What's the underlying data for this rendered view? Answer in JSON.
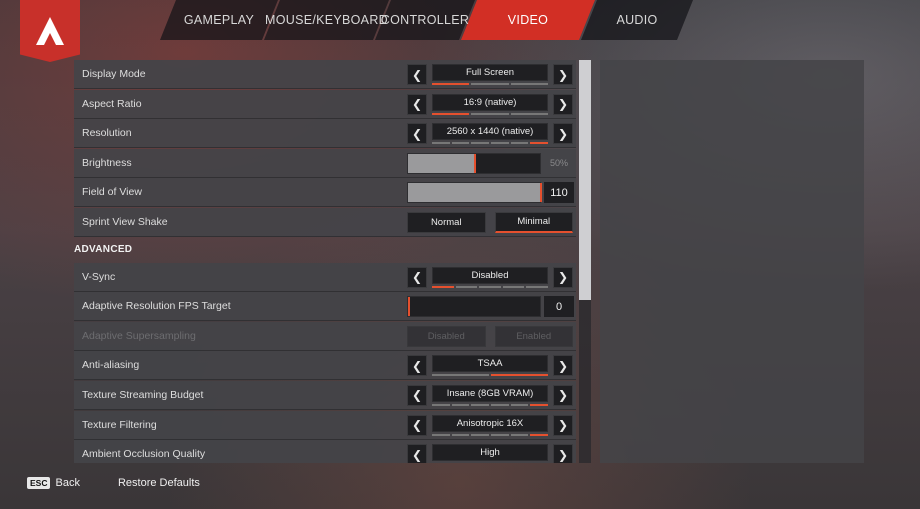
{
  "tabs": [
    {
      "label": "GAMEPLAY",
      "active": false
    },
    {
      "label": "MOUSE/KEYBOARD",
      "active": false
    },
    {
      "label": "CONTROLLER",
      "active": false
    },
    {
      "label": "VIDEO",
      "active": true
    },
    {
      "label": "AUDIO",
      "active": false
    }
  ],
  "settings": {
    "display_mode": {
      "label": "Display Mode",
      "value": "Full Screen",
      "option_index": 0,
      "option_count": 3
    },
    "aspect_ratio": {
      "label": "Aspect Ratio",
      "value": "16:9 (native)",
      "option_index": 0,
      "option_count": 3
    },
    "resolution": {
      "label": "Resolution",
      "value": "2560 x 1440 (native)",
      "option_index": 5,
      "option_count": 6
    },
    "brightness": {
      "label": "Brightness",
      "value": "50%",
      "fraction": 0.5
    },
    "fov": {
      "label": "Field of View",
      "value": "110",
      "fraction": 1.0
    },
    "sprint_view_shake": {
      "label": "Sprint View Shake",
      "options": [
        "Normal",
        "Minimal"
      ],
      "selected": "Minimal"
    }
  },
  "advanced_header": "ADVANCED",
  "advanced": {
    "vsync": {
      "label": "V-Sync",
      "value": "Disabled",
      "option_index": 0,
      "option_count": 5
    },
    "adaptive_res": {
      "label": "Adaptive Resolution FPS Target",
      "value": "0",
      "fraction": 0
    },
    "adaptive_ss": {
      "label": "Adaptive Supersampling",
      "options": [
        "Disabled",
        "Enabled"
      ]
    },
    "anti_aliasing": {
      "label": "Anti-aliasing",
      "value": "TSAA",
      "option_index": 1,
      "option_count": 2
    },
    "texture_budget": {
      "label": "Texture Streaming Budget",
      "value": "Insane (8GB VRAM)",
      "option_index": 5,
      "option_count": 6
    },
    "texture_filtering": {
      "label": "Texture Filtering",
      "value": "Anisotropic 16X",
      "option_index": 5,
      "option_count": 6
    },
    "ambient_occlusion": {
      "label": "Ambient Occlusion Quality",
      "value": "High"
    }
  },
  "footer": {
    "esc_key": "ESC",
    "back_label": "Back",
    "restore_label": "Restore Defaults"
  },
  "colors": {
    "accent": "#d22f25",
    "pip_on": "#e5502e"
  }
}
